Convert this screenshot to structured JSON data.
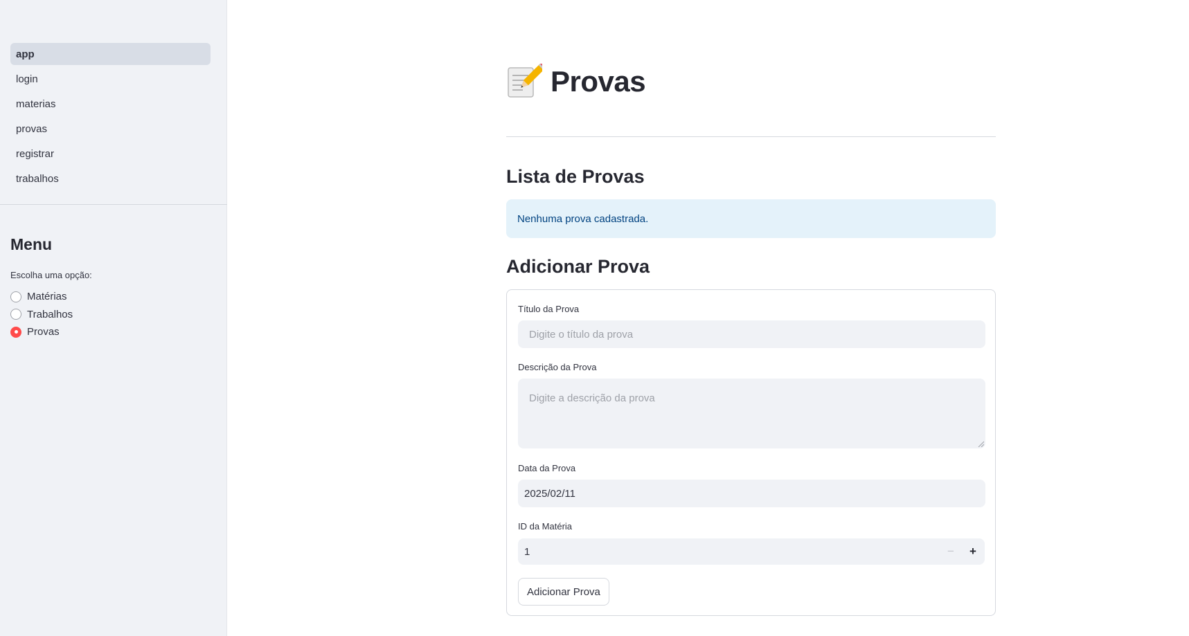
{
  "sidebar": {
    "nav_items": [
      {
        "label": "app",
        "active": true
      },
      {
        "label": "login",
        "active": false
      },
      {
        "label": "materias",
        "active": false
      },
      {
        "label": "provas",
        "active": false
      },
      {
        "label": "registrar",
        "active": false
      },
      {
        "label": "trabalhos",
        "active": false
      }
    ],
    "menu_title": "Menu",
    "radio_label": "Escolha uma opção:",
    "radio_options": [
      "Matérias",
      "Trabalhos",
      "Provas"
    ],
    "selected_option": "Provas"
  },
  "main": {
    "title_icon": "memo-pencil-icon",
    "title": "Provas",
    "list_heading": "Lista de Provas",
    "empty_info": "Nenhuma prova cadastrada.",
    "add_heading": "Adicionar Prova",
    "form": {
      "title_label": "Título da Prova",
      "title_placeholder": "Digite o título da prova",
      "description_label": "Descrição da Prova",
      "description_placeholder": "Digite a descrição da prova",
      "date_label": "Data da Prova",
      "date_value": "2025/02/11",
      "subject_id_label": "ID da Matéria",
      "subject_id_value": "1",
      "decrement_symbol": "−",
      "increment_symbol": "+",
      "submit_label": "Adicionar Prova"
    }
  },
  "colors": {
    "accent": "#ff4b4b",
    "sidebar_bg": "#f0f2f6",
    "info_bg": "#e4f2fa",
    "info_text": "#004280"
  }
}
